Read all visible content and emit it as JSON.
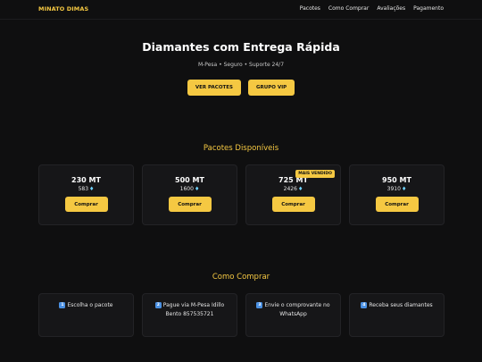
{
  "nav": {
    "brand": "MINATO DIMAS",
    "links": [
      "Pacotes",
      "Como Comprar",
      "Avaliações",
      "Pagamento"
    ]
  },
  "hero": {
    "title": "Diamantes com Entrega Rápida",
    "subtitle": "M-Pesa • Seguro • Suporte 24/7",
    "buttons": [
      "VER PACOTES",
      "GRUPO VIP"
    ]
  },
  "packages": {
    "title": "Pacotes Disponíveis",
    "buy_label": "Comprar",
    "badge": "MAIS VENDIDO",
    "items": [
      {
        "price": "230 MT",
        "diamonds": "583"
      },
      {
        "price": "500 MT",
        "diamonds": "1600"
      },
      {
        "price": "725 MT",
        "diamonds": "2426"
      },
      {
        "price": "950 MT",
        "diamonds": "3910"
      }
    ]
  },
  "how_to_buy": {
    "title": "Como Comprar",
    "steps": [
      {
        "number": "1",
        "text": "Escolha o pacote"
      },
      {
        "number": "2",
        "text": "Pague via M-Pesa Idillo Bento 857535721"
      },
      {
        "number": "3",
        "text": "Envie o comprovante no WhatsApp"
      },
      {
        "number": "4",
        "text": "Receba seus diamantes"
      }
    ]
  },
  "icons": {
    "diamond": "gem-icon",
    "step": "keycap-number-icon"
  },
  "colors": {
    "accent": "#f5c842",
    "background": "#0f0f10",
    "card": "#161618",
    "gem": "#6fd3ff",
    "keycap": "#4a90e2"
  }
}
